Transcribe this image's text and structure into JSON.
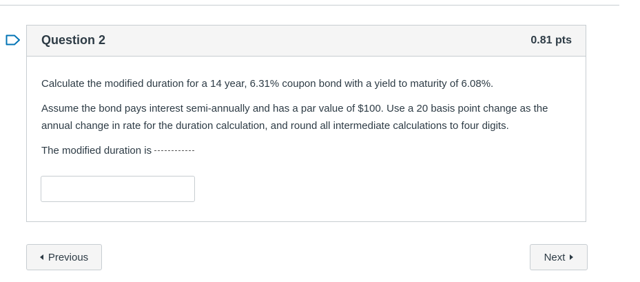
{
  "question": {
    "title": "Question 2",
    "points": "0.81 pts",
    "paragraph1": "Calculate the modified duration  for a 14 year, 6.31% coupon bond with a yield to maturity of 6.08%.",
    "paragraph2": "Assume the bond pays interest semi-annually and has a par value of $100. Use a 20 basis point change as the annual change in rate for the duration calculation, and round all intermediate calculations to four digits.",
    "paragraph3": "The modified duration is",
    "answer_value": "",
    "answer_placeholder": ""
  },
  "nav": {
    "previous_label": "Previous",
    "next_label": "Next"
  },
  "colors": {
    "flag": "#0374B5",
    "border": "#c7cdd1",
    "header_bg": "#f5f5f5",
    "text": "#2d3b45"
  },
  "icons": {
    "flag": "bookmark-flag-icon",
    "prev": "triangle-left-icon",
    "next": "triangle-right-icon"
  }
}
